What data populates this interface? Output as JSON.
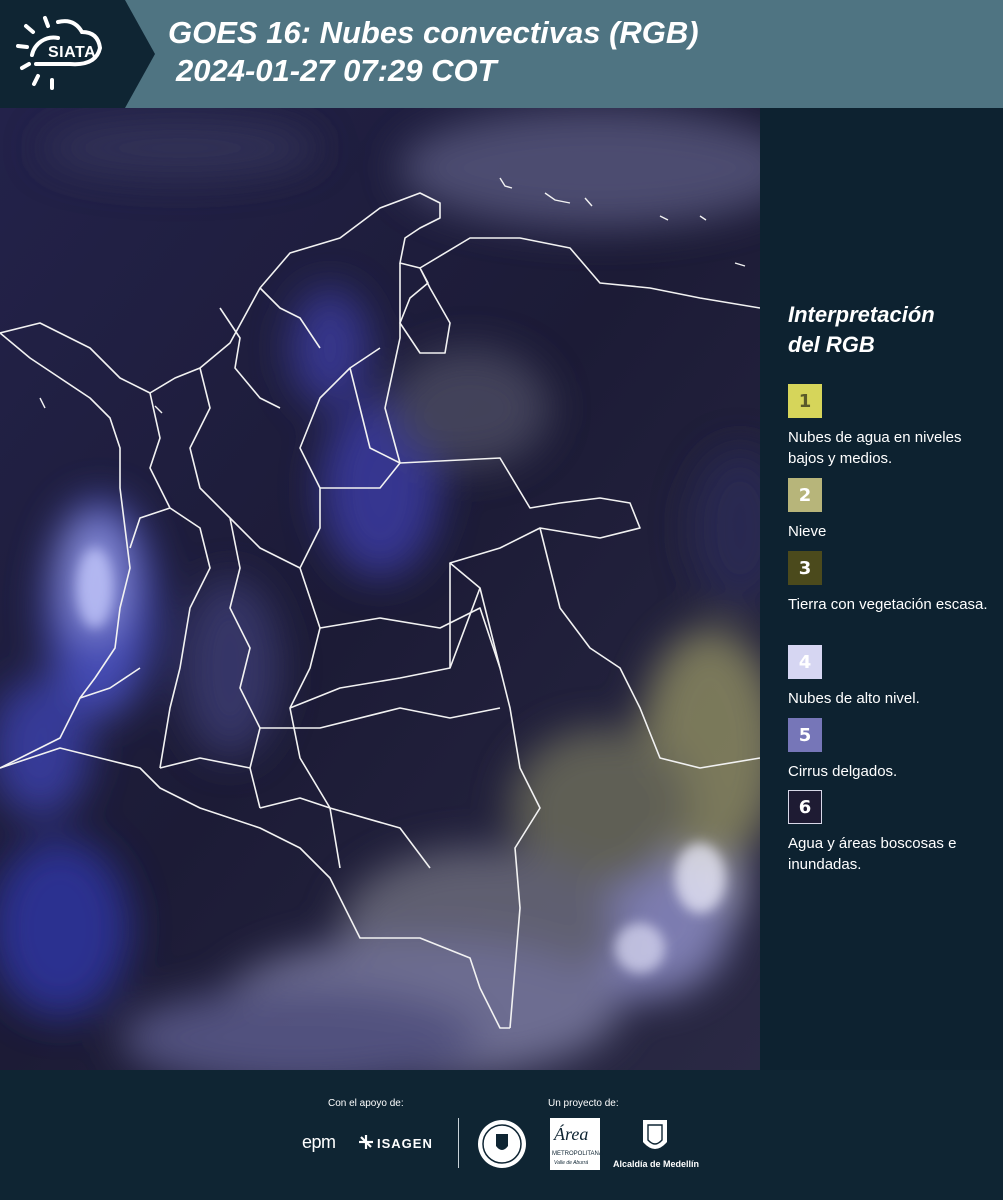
{
  "header": {
    "logo": "SIATA",
    "title": "GOES 16: Nubes convectivas (RGB)",
    "subtitle": "2024-01-27 07:29 COT"
  },
  "legend": {
    "title_line1": "Interpretación",
    "title_line2": "del RGB",
    "items": [
      {
        "number": "1",
        "label": "Nubes de agua en niveles bajos y medios.",
        "color": "#d6d55a",
        "text_color": "#5a5a2a"
      },
      {
        "number": "2",
        "label": "Nieve",
        "color": "#b7b57a",
        "text_color": "#ffffff"
      },
      {
        "number": "3",
        "label": "Tierra con vegetación escasa.",
        "color": "#4b4a1c",
        "text_color": "#ffffff"
      },
      {
        "number": "4",
        "label": "Nubes de alto nivel.",
        "color": "#d6d6f2",
        "text_color": "#ffffff"
      },
      {
        "number": "5",
        "label": "Cirrus delgados.",
        "color": "#7676b8",
        "text_color": "#ffffff"
      },
      {
        "number": "6",
        "label": "Agua y áreas boscosas e inundadas.",
        "color": "#1e1b33",
        "text_color": "#ffffff"
      }
    ]
  },
  "footer": {
    "support_label": "Con el apoyo de:",
    "project_label": "Un proyecto de:",
    "sponsors": {
      "epm": "epm",
      "isagen": "ISAGEN",
      "area": "Área",
      "area_sub": "METROPOLITANA",
      "area_sub2": "Valle de Aburrá",
      "alcaldia": "Alcaldía de Medellín"
    }
  }
}
